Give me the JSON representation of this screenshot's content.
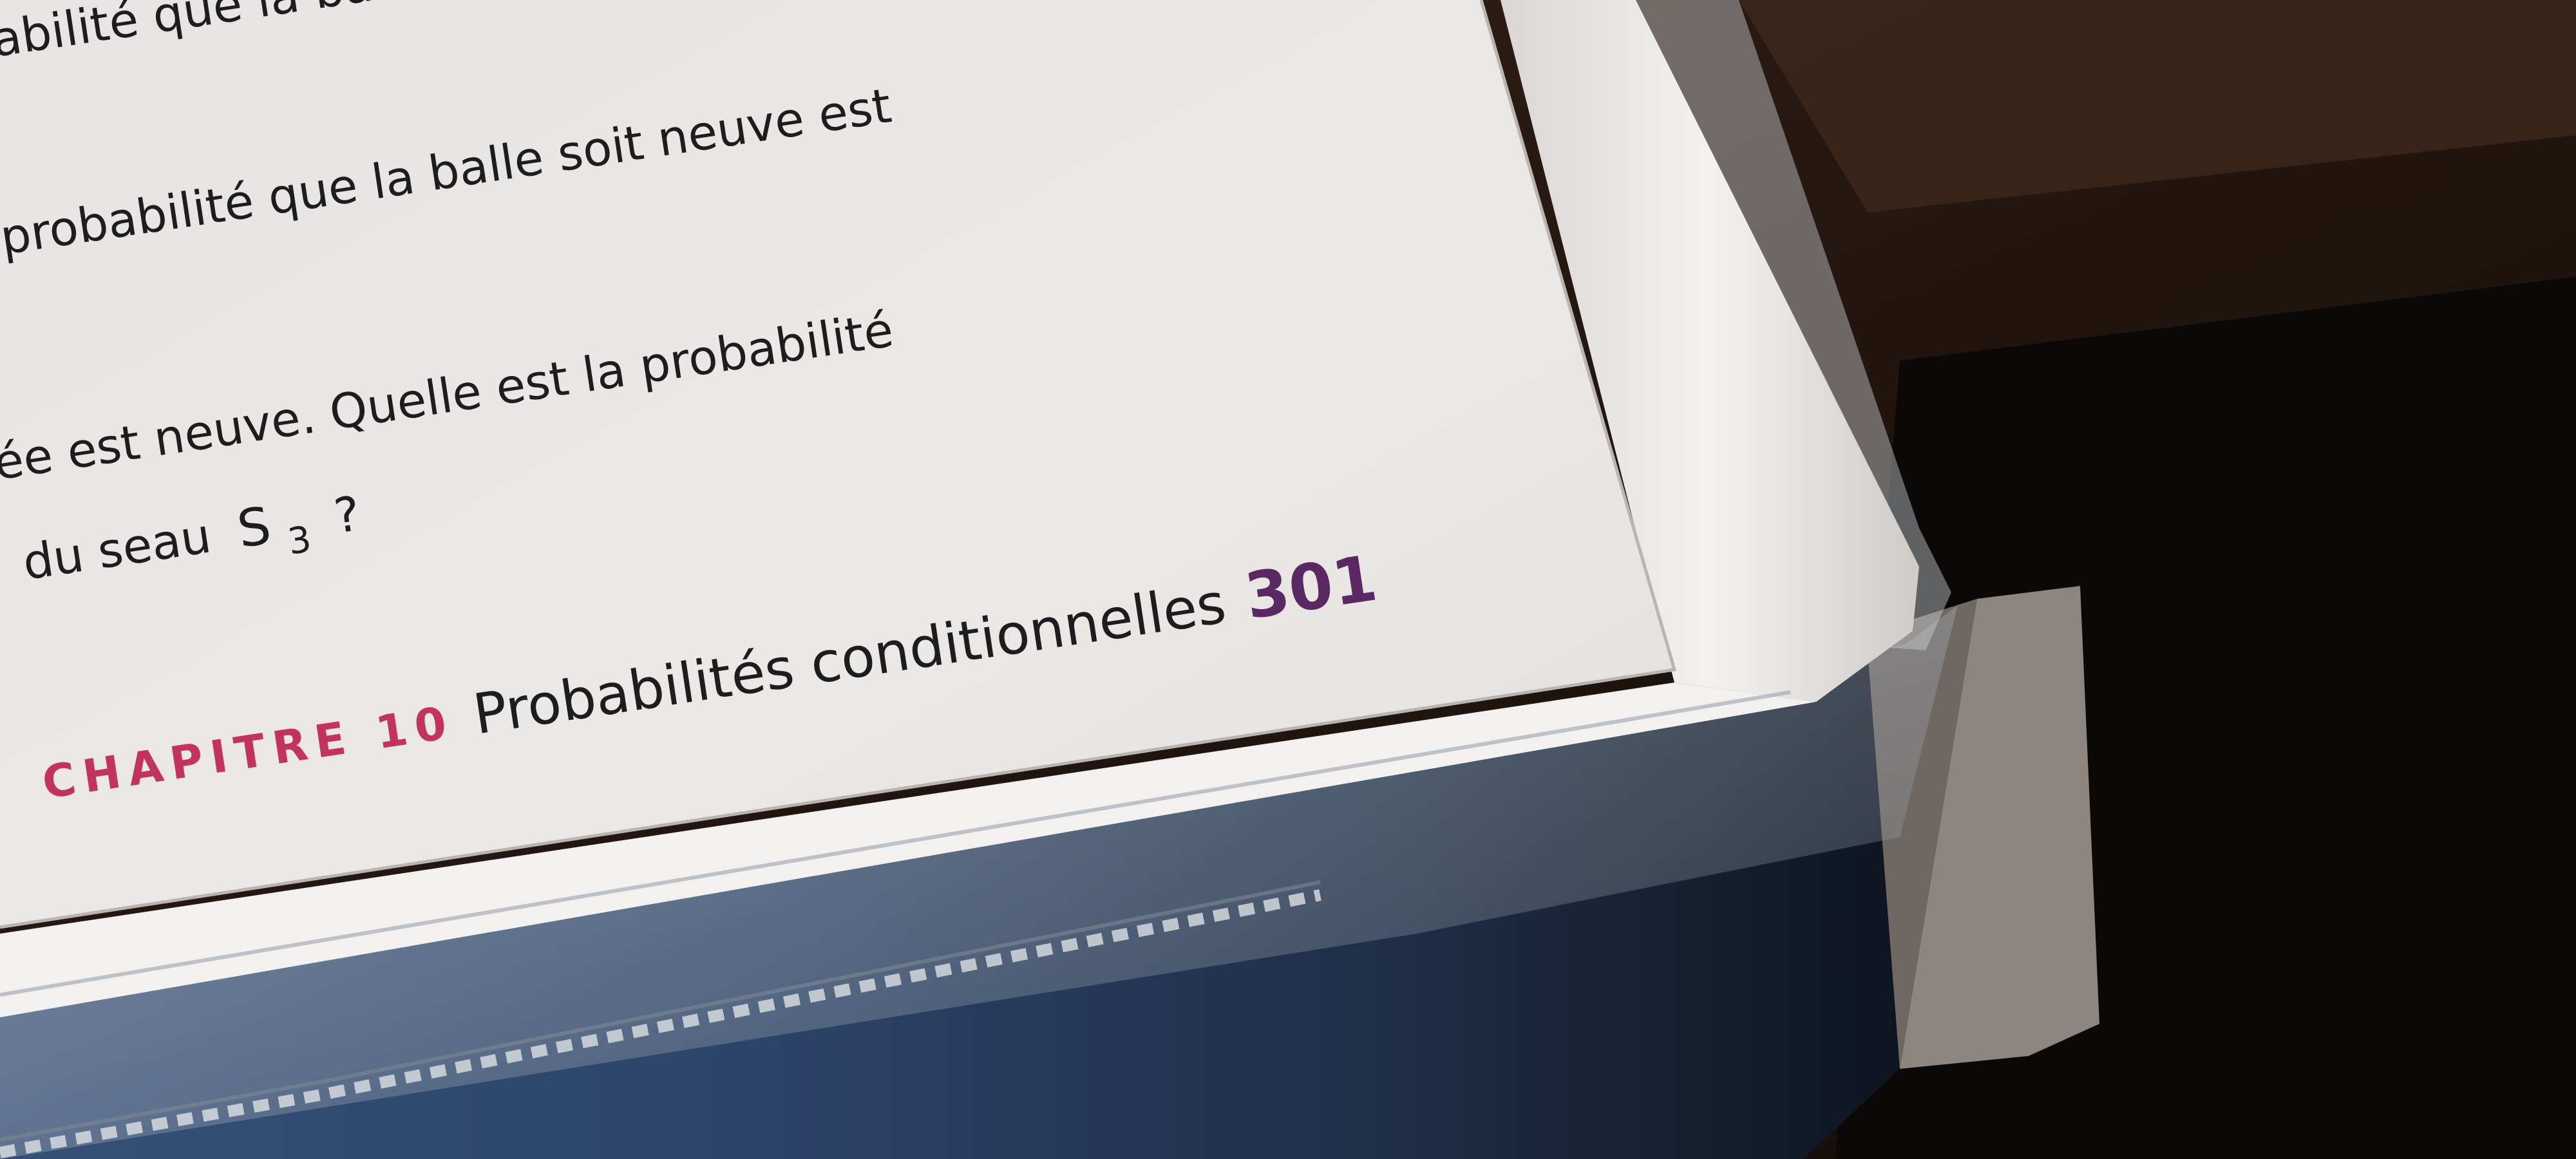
{
  "page": {
    "lines": [
      "abilité que la balle soit n",
      "probabilité que la balle soit neuve est",
      "ée est neuve. Quelle est la probabilité",
      "du seau"
    ],
    "bucket": {
      "letter": "S",
      "subscript": "3",
      "question_mark": "?"
    }
  },
  "footer": {
    "chapter_label": "CHAPITRE 10",
    "chapter_title": "Probabilités conditionnelles",
    "page_number": "301"
  },
  "colors": {
    "chapter_accent": "#c2335d",
    "page_number": "#5a2863",
    "text": "#1d1d1f",
    "paper": "#ebe8e6"
  }
}
